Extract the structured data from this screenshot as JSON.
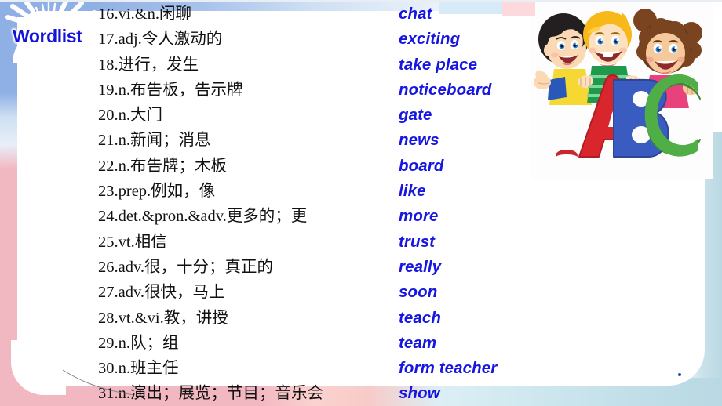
{
  "slide": {
    "heading": "Wordlist",
    "accent_blue": "#1414d8",
    "word_blue": "#1616e0",
    "band_blue": "#8fb0e4",
    "band_pink": "#f2b8c1",
    "band_teal": "#b9d8e3",
    "text_black": "#111111"
  },
  "wordlist": {
    "rows": [
      {
        "cn": "16.vi.&n.闲聊",
        "en": "chat"
      },
      {
        "cn": "17.adj.令人激动的",
        "en": "exciting"
      },
      {
        "cn": "18.进行，发生",
        "en": "take place"
      },
      {
        "cn": "19.n.布告板，告示牌",
        "en": "noticeboard"
      },
      {
        "cn": "20.n.大门",
        "en": "gate"
      },
      {
        "cn": "21.n.新闻；消息",
        "en": "news"
      },
      {
        "cn": "22.n.布告牌；木板",
        "en": "board"
      },
      {
        "cn": "23.prep.例如，像",
        "en": "like"
      },
      {
        "cn": "24.det.&pron.&adv.更多的；更",
        "en": "more"
      },
      {
        "cn": "25.vt.相信",
        "en": "trust"
      },
      {
        "cn": "26.adv.很，十分；真正的",
        "en": "really"
      },
      {
        "cn": "27.adv.很快，马上",
        "en": "soon"
      },
      {
        "cn": "28.vt.&vi.教，讲授",
        "en": "teach"
      },
      {
        "cn": "29.n.队；组",
        "en": "team"
      },
      {
        "cn": "30.n.班主任",
        "en": "form teacher"
      },
      {
        "cn": "31.n.演出；展览；节目；音乐会",
        "en": "show"
      }
    ]
  },
  "clipart": {
    "description": "three-cartoon-children-holding-abc-letters",
    "letters": [
      "A",
      "B",
      "C"
    ],
    "letter_colors": [
      "#d8262c",
      "#3a5bbf",
      "#4fae45"
    ],
    "hair_colors": [
      "#231f20",
      "#f7b819",
      "#7a4420"
    ]
  }
}
